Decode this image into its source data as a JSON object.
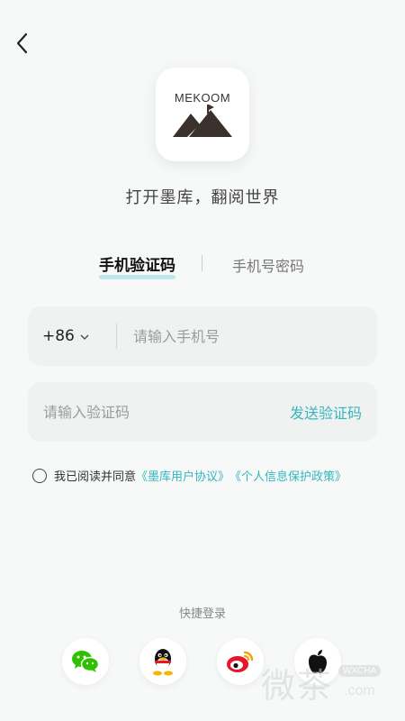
{
  "logo": {
    "brand": "MEKOOM"
  },
  "slogan": "打开墨库，翻阅世界",
  "tabs": {
    "active": "手机验证码",
    "inactive": "手机号密码"
  },
  "phone_field": {
    "country_code": "+86",
    "placeholder": "请输入手机号"
  },
  "code_field": {
    "placeholder": "请输入验证码",
    "send_label": "发送验证码"
  },
  "agreement": {
    "prefix": "我已阅读并同意",
    "user_agreement": "《墨库用户协议》",
    "privacy_policy": "《个人信息保护政策》"
  },
  "quick_login": {
    "label": "快捷登录",
    "providers": [
      "wechat-icon",
      "qq-icon",
      "weibo-icon",
      "apple-icon"
    ]
  },
  "watermark": {
    "cn": "微茶",
    "badge": "WXCHA",
    "com": ".com"
  },
  "colors": {
    "accent": "#35b6bd",
    "tab_underline": "#bfe8ea",
    "wechat": "#2dc100",
    "weibo": "#e6162d",
    "background": "#f7f9f9"
  }
}
